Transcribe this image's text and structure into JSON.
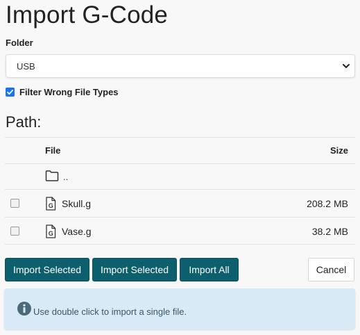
{
  "header": {
    "title": "Import G-Code"
  },
  "folder": {
    "label": "Folder",
    "selected": "USB"
  },
  "filter": {
    "label": "Filter Wrong File Types",
    "checked": true
  },
  "path": {
    "label": "Path:"
  },
  "table": {
    "columns": {
      "file": "File",
      "size": "Size"
    },
    "parent_label": "..",
    "rows": [
      {
        "name": "Skull.g",
        "size": "208.2 MB",
        "icon": "gcode-file-icon"
      },
      {
        "name": "Vase.g",
        "size": "38.2 MB",
        "icon": "gcode-file-icon"
      }
    ],
    "file_icon_letter": "G"
  },
  "actions": {
    "import_selected_1": "Import Selected",
    "import_selected_2": "Import Selected",
    "import_all": "Import All",
    "cancel": "Cancel"
  },
  "info": {
    "text": "Use double click to import a single file.",
    "icon": "info-circle-icon"
  },
  "colors": {
    "primary_button": "#0d5f6e",
    "checkbox_accent": "#1a73e8",
    "info_background": "#d7eaf5",
    "info_icon": "#4d6a7d"
  }
}
